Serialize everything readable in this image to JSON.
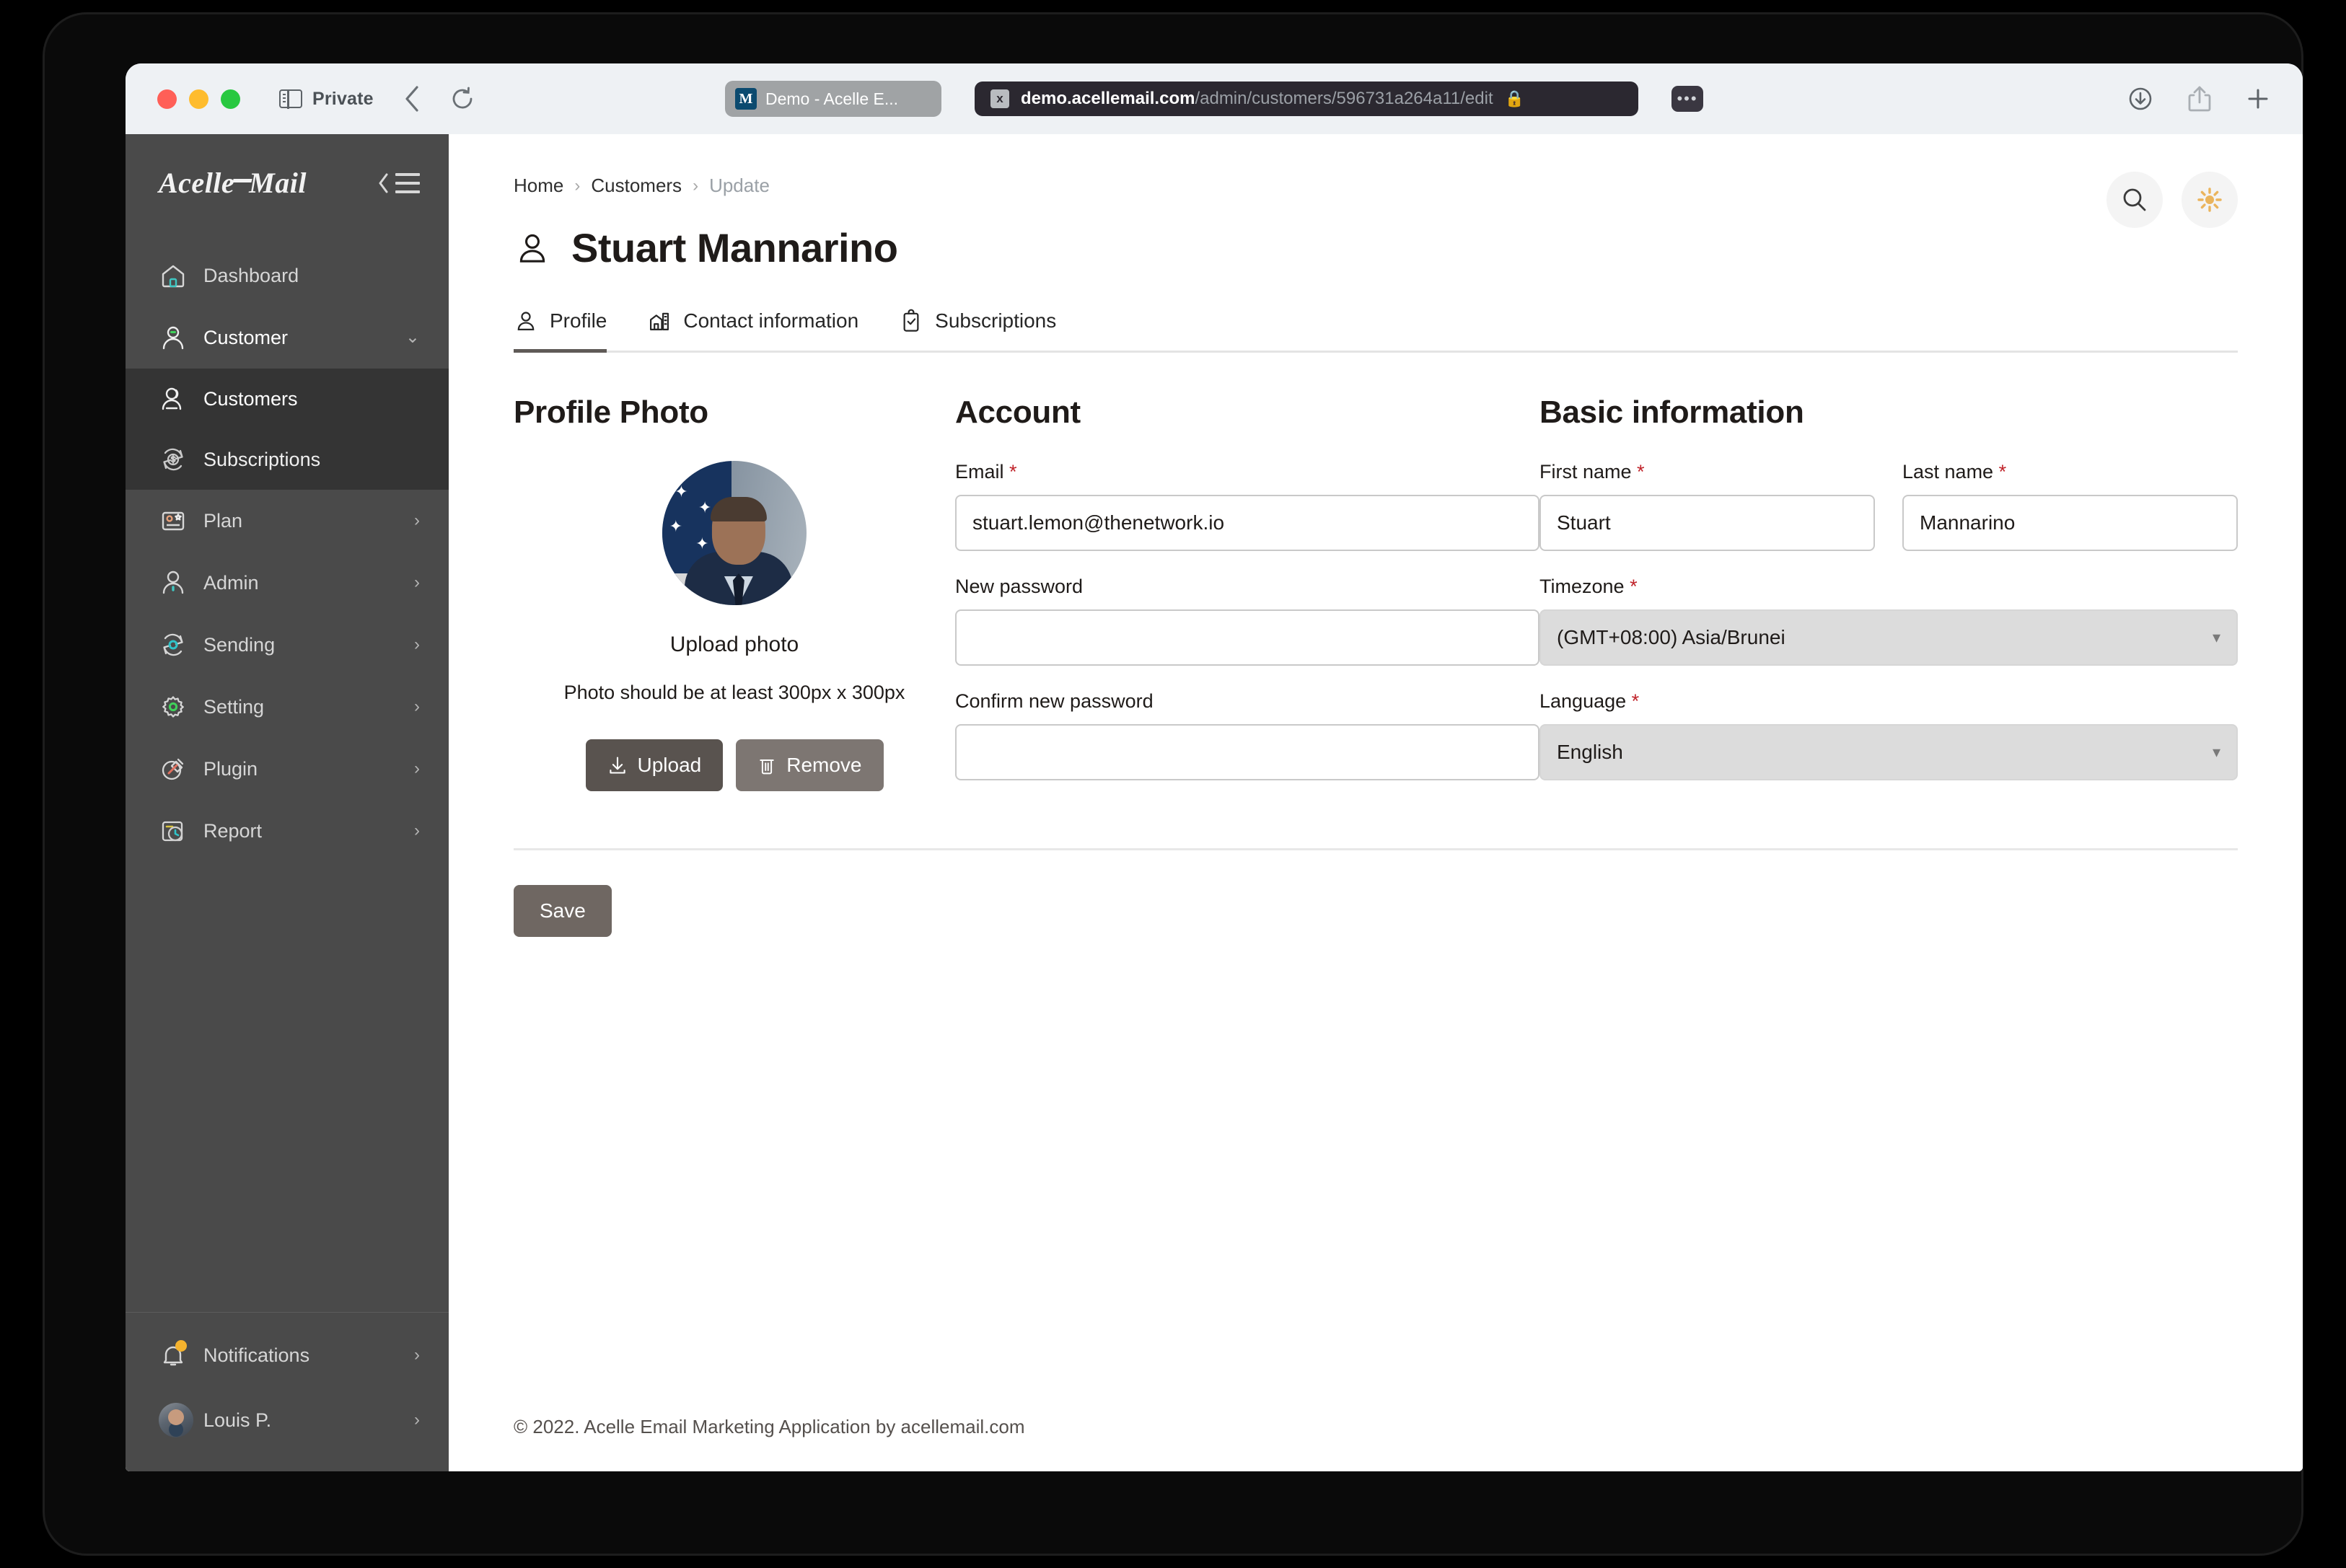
{
  "browser": {
    "private_label": "Private",
    "back_icon": "chevron-left-icon",
    "reload_icon": "reload-icon",
    "sidebar_icon": "panel-toggle-icon",
    "tab": {
      "favicon_letter": "M",
      "title": "Demo - Acelle E..."
    },
    "url": {
      "host": "demo.acellemail.com",
      "path": "/admin/customers/596731a264a11/edit",
      "shield_label": "x",
      "lock_icon": "lock-icon",
      "menu_label": "•••"
    },
    "right_icons": [
      "downloads-icon",
      "share-icon",
      "new-tab-icon"
    ]
  },
  "sidebar": {
    "logo": {
      "part1": "Acelle",
      "part2": "Mail"
    },
    "collapse_label": "collapse-sidebar",
    "items": [
      {
        "label": "Dashboard",
        "icon": "home-icon",
        "caret": "",
        "state": "default"
      },
      {
        "label": "Customer",
        "icon": "user-icon",
        "caret": "⌄",
        "state": "expanded"
      },
      {
        "label": "Customers",
        "icon": "user-headset-icon",
        "caret": "",
        "state": "current",
        "sub": true
      },
      {
        "label": "Subscriptions",
        "icon": "dollar-refresh-icon",
        "caret": "",
        "state": "sub",
        "sub": true
      },
      {
        "label": "Plan",
        "icon": "plan-card-icon",
        "caret": "›",
        "state": "default"
      },
      {
        "label": "Admin",
        "icon": "admin-user-icon",
        "caret": "›",
        "state": "default"
      },
      {
        "label": "Sending",
        "icon": "sending-gear-icon",
        "caret": "›",
        "state": "default"
      },
      {
        "label": "Setting",
        "icon": "gear-icon",
        "caret": "›",
        "state": "default"
      },
      {
        "label": "Plugin",
        "icon": "plug-icon",
        "caret": "›",
        "state": "default"
      },
      {
        "label": "Report",
        "icon": "report-clock-icon",
        "caret": "›",
        "state": "default"
      }
    ],
    "footer": [
      {
        "label": "Notifications",
        "icon": "bell-icon",
        "caret": "›",
        "badge": true
      },
      {
        "label": "Louis P.",
        "icon": "avatar",
        "caret": "›",
        "badge": false
      }
    ]
  },
  "header": {
    "breadcrumb": [
      {
        "label": "Home",
        "current": false
      },
      {
        "label": "Customers",
        "current": false
      },
      {
        "label": "Update",
        "current": true
      }
    ],
    "separator": "›",
    "title": "Stuart Mannarino",
    "title_icon": "user-icon",
    "search_icon": "search-icon",
    "theme_icon": "sun-icon",
    "theme_icon_color": "#eab45c"
  },
  "tabs": [
    {
      "label": "Profile",
      "icon": "user-icon",
      "active": true
    },
    {
      "label": "Contact information",
      "icon": "building-icon",
      "active": false
    },
    {
      "label": "Subscriptions",
      "icon": "clipboard-check-icon",
      "active": false
    }
  ],
  "photo_section": {
    "title": "Profile Photo",
    "upload_label": "Upload photo",
    "hint": "Photo should be at least 300px x 300px",
    "upload_button": "Upload",
    "upload_button_icon": "download-icon",
    "remove_button": "Remove",
    "remove_button_icon": "trash-icon",
    "avatar_name": "profile-photo"
  },
  "account_section": {
    "title": "Account",
    "fields": [
      {
        "label": "Email",
        "required": true,
        "value": "stuart.lemon@thenetwork.io",
        "type": "text"
      },
      {
        "label": "New password",
        "required": false,
        "value": "",
        "type": "password"
      },
      {
        "label": "Confirm new password",
        "required": false,
        "value": "",
        "type": "password"
      }
    ]
  },
  "basic_section": {
    "title": "Basic information",
    "first_name": {
      "label": "First name",
      "required": true,
      "value": "Stuart"
    },
    "last_name": {
      "label": "Last name",
      "required": true,
      "value": "Mannarino"
    },
    "timezone": {
      "label": "Timezone",
      "required": true,
      "value": "(GMT+08:00) Asia/Brunei"
    },
    "language": {
      "label": "Language",
      "required": true,
      "value": "English"
    },
    "caret": "▾"
  },
  "actions": {
    "save_label": "Save"
  },
  "footer": {
    "text": "© 2022. Acelle Email Marketing Application by acellemail.com"
  },
  "colors": {
    "sidebar_bg": "#4a4a4a",
    "submenu_bg": "#343434",
    "accent_button": "#59534f",
    "required": "#c0232a",
    "sun": "#eab45c"
  }
}
